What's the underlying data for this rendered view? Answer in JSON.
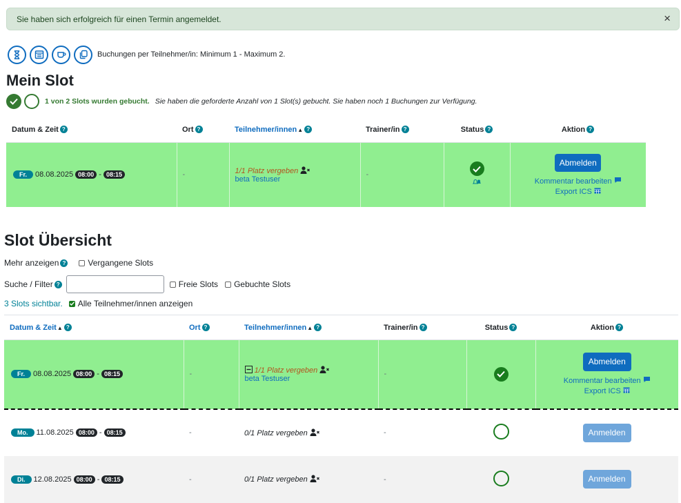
{
  "alert": {
    "message": "Sie haben sich erfolgreich für einen Termin angemeldet.",
    "close": "×"
  },
  "toolbar": {
    "info": "Buchungen per Teilnehmer/in: Minimum 1 - Maximum 2."
  },
  "my_slot": {
    "title": "Mein Slot",
    "progress_strong": "1 von 2 Slots wurden gebucht.",
    "progress_text": "Sie haben die geforderte Anzahl von 1 Slot(s) gebucht. Sie haben noch 1 Buchungen zur Verfügung.",
    "headers": {
      "datetime": "Datum & Zeit",
      "location": "Ort",
      "participants": "Teilnehmer/innen",
      "trainer": "Trainer/in",
      "status": "Status",
      "action": "Aktion"
    },
    "row": {
      "day": "Fr.",
      "date": "08.08.2025",
      "start": "08:00",
      "sep": "-",
      "end": "08:15",
      "location": "-",
      "places": "1/1 Platz vergeben",
      "user": "beta Testuser",
      "trainer": "-",
      "button": "Abmelden",
      "comment": "Kommentar bearbeiten",
      "export": "Export ICS"
    }
  },
  "overview": {
    "title": "Slot Übersicht",
    "more_label": "Mehr anzeigen",
    "past_slots": "Vergangene Slots",
    "search_label": "Suche / Filter",
    "search_value": "",
    "free_slots": "Freie Slots",
    "booked_slots": "Gebuchte Slots",
    "visible_count": "3 Slots sichtbar.",
    "show_all": "Alle Teilnehmer/innen anzeigen",
    "headers": {
      "datetime": "Datum & Zeit",
      "location": "Ort",
      "participants": "Teilnehmer/innen",
      "trainer": "Trainer/in",
      "status": "Status",
      "action": "Aktion"
    },
    "rows": [
      {
        "day": "Fr.",
        "date": "08.08.2025",
        "start": "08:00",
        "sep": "-",
        "end": "08:15",
        "location": "-",
        "places": "1/1 Platz vergeben",
        "user": "beta Testuser",
        "trainer": "-",
        "button": "Abmelden",
        "comment": "Kommentar bearbeiten",
        "export": "Export ICS"
      },
      {
        "day": "Mo.",
        "date": "11.08.2025",
        "start": "08:00",
        "sep": "-",
        "end": "08:15",
        "location": "-",
        "places": "0/1 Platz vergeben",
        "trainer": "-",
        "button": "Anmelden"
      },
      {
        "day": "Di.",
        "date": "12.08.2025",
        "start": "08:00",
        "sep": "-",
        "end": "08:15",
        "location": "-",
        "places": "0/1 Platz vergeben",
        "trainer": "-",
        "button": "Anmelden"
      }
    ]
  },
  "colors": {
    "primary": "#0f6cbf",
    "booked_row": "#90ee90",
    "success": "#197c1e",
    "badge": "#008196"
  }
}
